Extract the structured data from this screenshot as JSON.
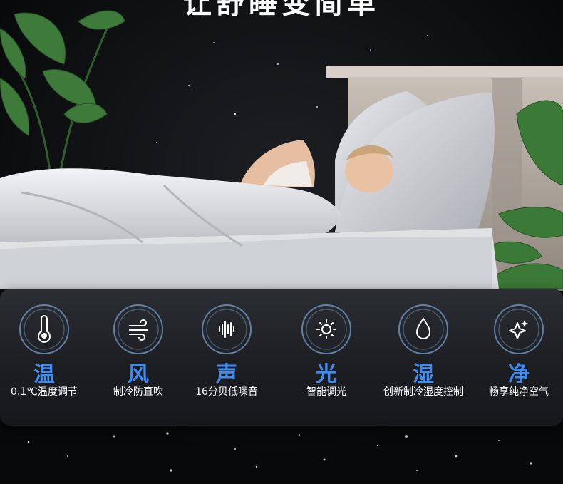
{
  "headline": "让舒睡变简单",
  "features": [
    {
      "title": "温",
      "desc": "0.1℃温度调节",
      "icon": "thermometer-icon"
    },
    {
      "title": "风",
      "desc": "制冷防直吹",
      "icon": "wind-icon"
    },
    {
      "title": "声",
      "desc": "16分贝低噪音",
      "icon": "sound-wave-icon"
    },
    {
      "title": "光",
      "desc": "智能调光",
      "icon": "sun-icon"
    },
    {
      "title": "湿",
      "desc": "创新制冷湿度控制",
      "icon": "water-drop-icon"
    },
    {
      "title": "净",
      "desc": "畅享纯净空气",
      "icon": "sparkle-icon"
    }
  ],
  "colors": {
    "accent": "#3f8cf0",
    "panel": "#1f2226",
    "background": "#0b0c0e"
  }
}
